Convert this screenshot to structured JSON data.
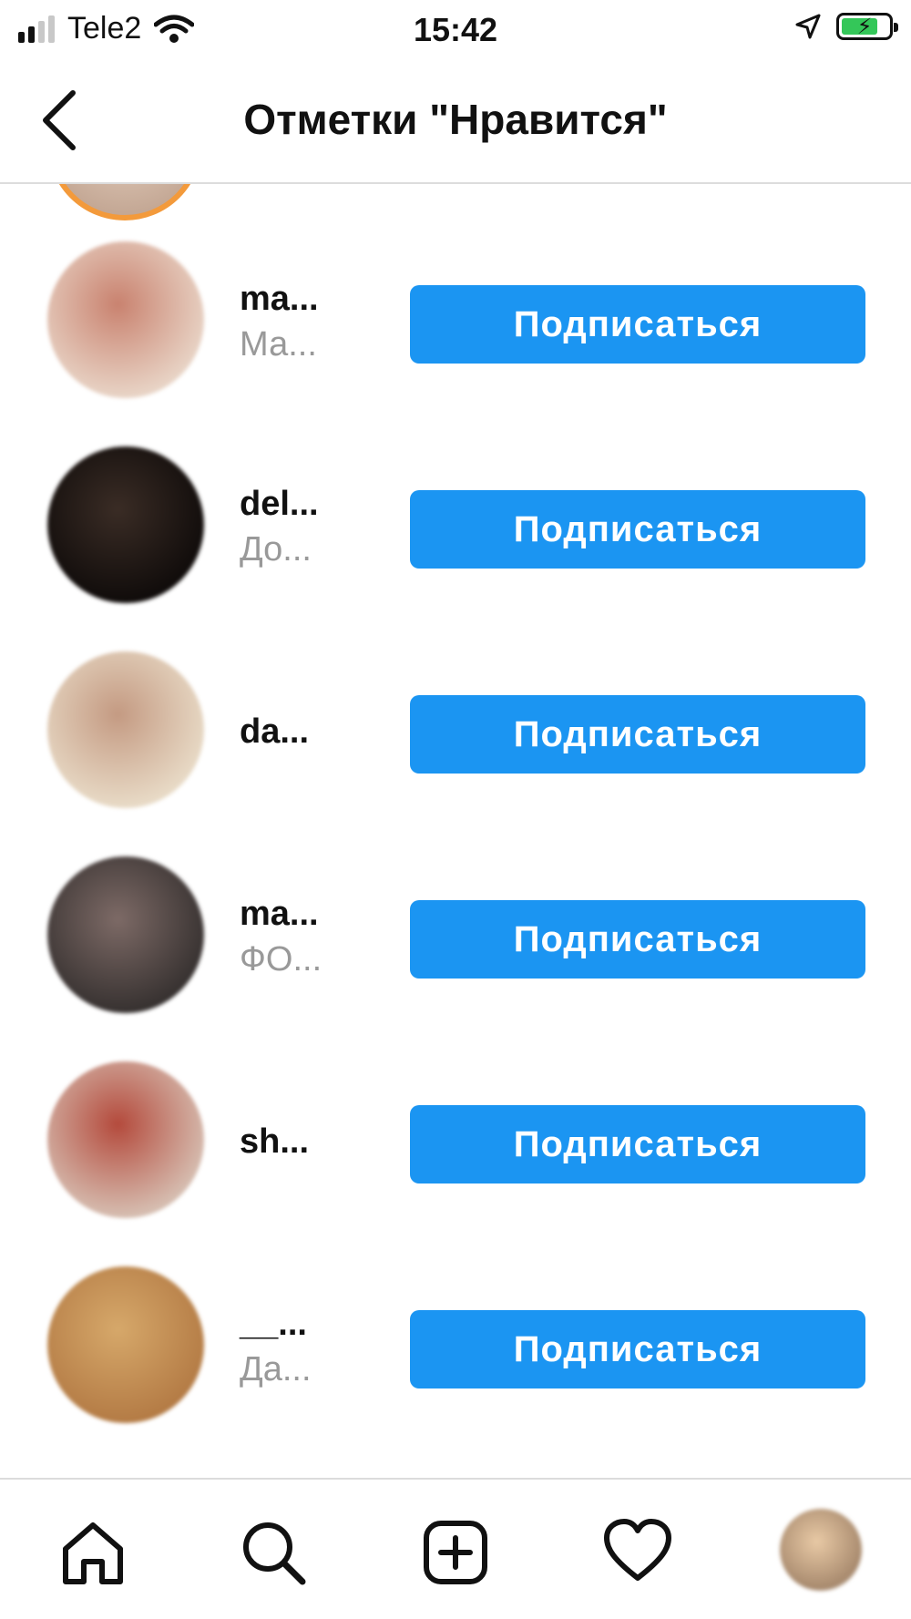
{
  "status_bar": {
    "carrier": "Tele2",
    "time": "15:42",
    "battery_charging": true,
    "battery_level": 0.8,
    "icons": [
      "signal-icon",
      "wifi-icon",
      "location-arrow-icon",
      "battery-icon"
    ]
  },
  "header": {
    "title": "Отметки \"Нравится\"",
    "back_icon": "chevron-left-icon"
  },
  "likes_list": [
    {
      "username": "ma...",
      "full_name": "Ма...",
      "button_label": "Подписаться",
      "avatar_colors": [
        "#c9826f",
        "#e9d6c8"
      ]
    },
    {
      "username": "del...",
      "full_name": "До...",
      "button_label": "Подписаться",
      "avatar_colors": [
        "#3a2c25",
        "#0f0b0a"
      ]
    },
    {
      "username": "da...",
      "full_name": "",
      "button_label": "Подписаться",
      "avatar_colors": [
        "#c49a82",
        "#e9dcc8"
      ]
    },
    {
      "username": "ma...",
      "full_name": "ФО...",
      "button_label": "Подписаться",
      "avatar_colors": [
        "#7d6a66",
        "#35302f"
      ]
    },
    {
      "username": "sh...",
      "full_name": "",
      "button_label": "Подписаться",
      "avatar_colors": [
        "#b44a3c",
        "#d7c1b4"
      ]
    },
    {
      "username": "__...",
      "full_name": "Да...",
      "button_label": "Подписаться",
      "avatar_colors": [
        "#d6a86a",
        "#b37a44"
      ]
    }
  ],
  "tab_bar": {
    "items": [
      "home-icon",
      "search-icon",
      "add-post-icon",
      "activity-heart-icon",
      "profile-avatar"
    ]
  },
  "colors": {
    "follow_button": "#1b95f2",
    "story_ring": "#f39a3b",
    "secondary_text": "#999999"
  }
}
